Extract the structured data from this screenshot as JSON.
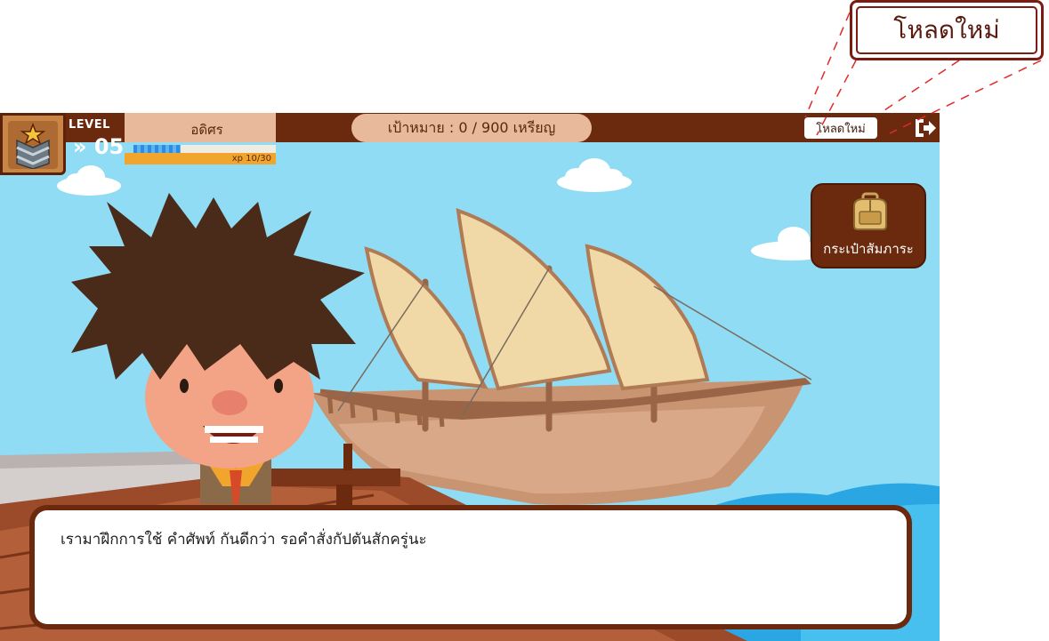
{
  "callout": {
    "label": "โหลดใหม่"
  },
  "hud": {
    "level_label": "LEVEL",
    "level_value": "» 05",
    "player_name": "อดิศร",
    "xp_text": "xp 10/30",
    "xp_fraction": 0.333,
    "goal_text": "เป้าหมาย : 0 / 900 เหรียญ",
    "reload_label": "โหลดใหม่"
  },
  "inventory": {
    "label": "กระเป๋าสัมภาระ"
  },
  "dialog": {
    "text": "เรามาฝึกการใช้ คำศัพท์ กันดีกว่า รอคำสั่งกัปตันสักครู่นะ"
  },
  "icons": {
    "rank": "rank-chevron-star-icon",
    "exit": "exit-door-icon",
    "backpack": "backpack-icon"
  },
  "colors": {
    "bar": "#6b2a0e",
    "panel": "#e8b99a",
    "xp_fill": "#2d8de0",
    "xp_bg": "#f2a52c",
    "sky": "#8fdcf4",
    "callout_border": "#7a1c12"
  }
}
